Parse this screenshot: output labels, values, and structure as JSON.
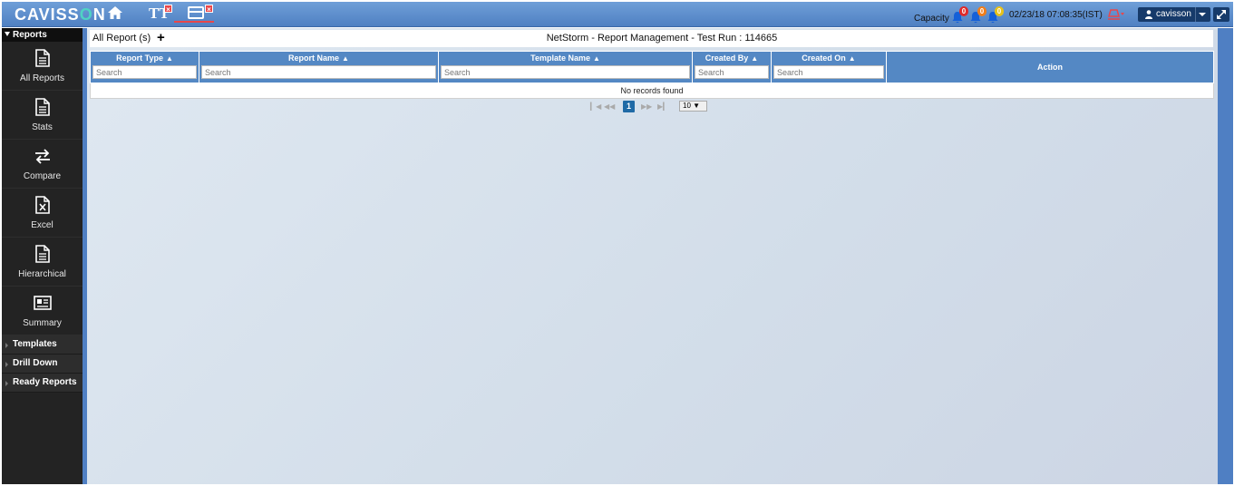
{
  "header": {
    "logo_left": "CAVISS",
    "logo_o": "O",
    "logo_right": "N",
    "tab_tt_label": "TT",
    "close_mark": "×",
    "capacity_label": "Capacity",
    "alerts": [
      {
        "count": "0",
        "color": "#e02b2b"
      },
      {
        "count": "0",
        "color": "#ef7d1a"
      },
      {
        "count": "0",
        "color": "#e7c21a"
      }
    ],
    "datetime": "02/23/18 07:08:35(IST)",
    "user": "cavisson",
    "accent": "#4f80c2"
  },
  "sidebar": {
    "heading": "Reports",
    "items": [
      {
        "label": "All Reports",
        "icon": "document-icon"
      },
      {
        "label": "Stats",
        "icon": "document-icon"
      },
      {
        "label": "Compare",
        "icon": "swap-arrows-icon"
      },
      {
        "label": "Excel",
        "icon": "excel-file-icon"
      },
      {
        "label": "Hierarchical",
        "icon": "document-icon"
      },
      {
        "label": "Summary",
        "icon": "newspaper-icon"
      }
    ],
    "sections": [
      "Templates",
      "Drill Down",
      "Ready Reports"
    ]
  },
  "main": {
    "panel_title": "All Report (s)",
    "add_label": "+",
    "page_heading": "NetStorm - Report Management - Test Run : 114665",
    "columns": [
      {
        "label": "Report Type",
        "sortable": true,
        "placeholder": "Search"
      },
      {
        "label": "Report Name",
        "sortable": true,
        "placeholder": "Search"
      },
      {
        "label": "Template Name",
        "sortable": true,
        "placeholder": "Search"
      },
      {
        "label": "Created By",
        "sortable": true,
        "placeholder": "Search"
      },
      {
        "label": "Created On",
        "sortable": true,
        "placeholder": "Search"
      },
      {
        "label": "Action",
        "sortable": false
      }
    ],
    "empty_message": "No records found",
    "pager": {
      "current_page": "1",
      "rows_per_page": "10 ▼"
    }
  }
}
